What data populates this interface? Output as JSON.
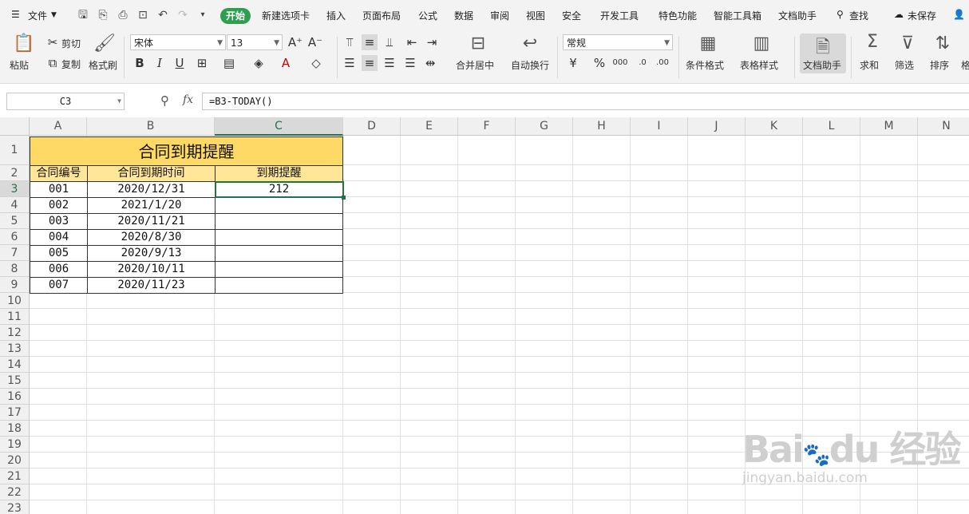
{
  "menu": {
    "file": "文件",
    "tabs": [
      "开始",
      "新建选项卡",
      "插入",
      "页面布局",
      "公式",
      "数据",
      "审阅",
      "视图",
      "安全",
      "开发工具",
      "特色功能",
      "智能工具箱",
      "文档助手"
    ],
    "search": "查找",
    "unsaved": "未保存"
  },
  "ribbon": {
    "paste": "粘贴",
    "cut": "剪切",
    "copy": "复制",
    "format_painter": "格式刷",
    "font_name": "宋体",
    "font_size": "13",
    "merge_center": "合并居中",
    "wrap_text": "自动换行",
    "number_format": "常规",
    "conditional_format": "条件格式",
    "table_style": "表格样式",
    "doc_assistant": "文档助手",
    "sum": "求和",
    "filter": "筛选",
    "sort": "排序",
    "cut_off": "格"
  },
  "formula_bar": {
    "name_box": "C3",
    "fx": "fx",
    "formula": "=B3-TODAY()"
  },
  "columns": [
    "A",
    "B",
    "C",
    "D",
    "E",
    "F",
    "G",
    "H",
    "I",
    "J",
    "K",
    "L",
    "M",
    "N"
  ],
  "rows": [
    "1",
    "2",
    "3",
    "4",
    "5",
    "6",
    "7",
    "8",
    "9",
    "10",
    "11",
    "12",
    "13",
    "14",
    "15",
    "16",
    "17",
    "18",
    "19",
    "20",
    "21",
    "22",
    "23"
  ],
  "sheet": {
    "title": "合同到期提醒",
    "headers": [
      "合同编号",
      "合同到期时间",
      "到期提醒"
    ],
    "data": [
      [
        "001",
        "2020/12/31",
        "212"
      ],
      [
        "002",
        "2021/1/20",
        ""
      ],
      [
        "003",
        "2020/11/21",
        ""
      ],
      [
        "004",
        "2020/8/30",
        ""
      ],
      [
        "005",
        "2020/9/13",
        ""
      ],
      [
        "006",
        "2020/10/11",
        ""
      ],
      [
        "007",
        "2020/11/23",
        ""
      ]
    ]
  },
  "watermark": {
    "logo": "Bai du 经验",
    "url": "jingyan.baidu.com"
  },
  "colors": {
    "accent": "#217346",
    "tab_active": "#2e9e4f",
    "title_fill": "#ffd966",
    "header_fill": "#ffe699"
  }
}
